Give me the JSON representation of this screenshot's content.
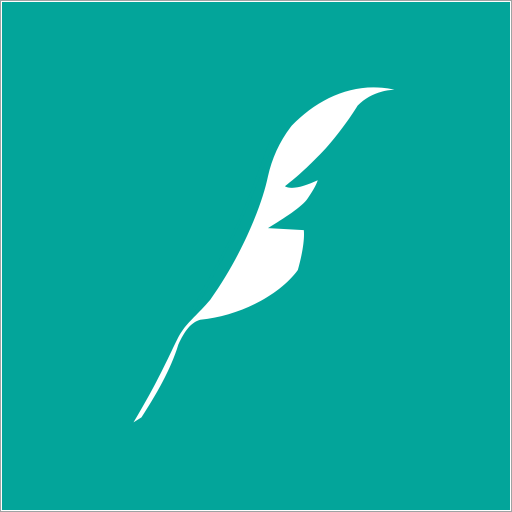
{
  "app_icon": {
    "icon": "feather-quill-icon",
    "colors": {
      "background": "#03a59a",
      "glyph": "#ffffff",
      "border": "#9fa3a3"
    }
  }
}
